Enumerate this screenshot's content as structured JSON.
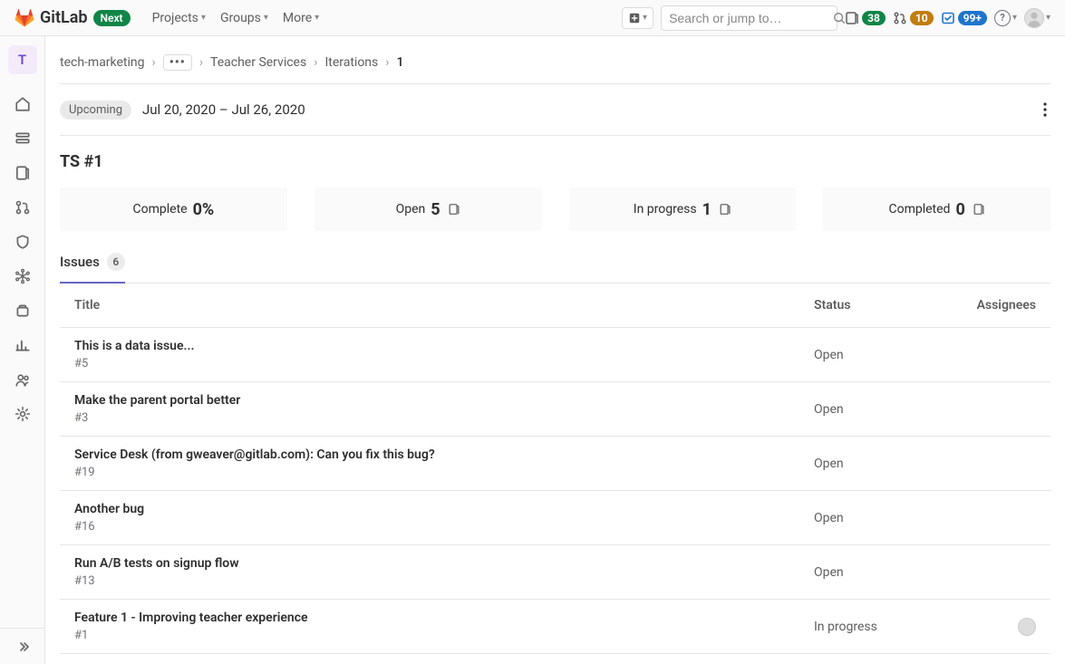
{
  "brand": {
    "name": "GitLab",
    "next_badge": "Next"
  },
  "nav": {
    "projects": "Projects",
    "groups": "Groups",
    "more": "More"
  },
  "search": {
    "placeholder": "Search or jump to…"
  },
  "counters": {
    "issues": "38",
    "mrs": "10",
    "todos": "99+"
  },
  "sidebar": {
    "project_initial": "T"
  },
  "breadcrumbs": {
    "root": "tech-marketing",
    "group": "Teacher Services",
    "section": "Iterations",
    "current": "1"
  },
  "iteration": {
    "status": "Upcoming",
    "date_range": "Jul 20, 2020 – Jul 26, 2020",
    "title": "TS #1"
  },
  "stats": {
    "complete": {
      "label": "Complete",
      "value": "0%"
    },
    "open": {
      "label": "Open",
      "value": "5"
    },
    "in_progress": {
      "label": "In progress",
      "value": "1"
    },
    "completed": {
      "label": "Completed",
      "value": "0"
    }
  },
  "tabs": {
    "issues": {
      "label": "Issues",
      "count": "6"
    }
  },
  "table": {
    "headers": {
      "title": "Title",
      "status": "Status",
      "assignees": "Assignees"
    }
  },
  "issues": [
    {
      "title": "This is a data issue...",
      "ref": "#5",
      "status": "Open",
      "has_assignee": false
    },
    {
      "title": "Make the parent portal better",
      "ref": "#3",
      "status": "Open",
      "has_assignee": false
    },
    {
      "title": "Service Desk (from gweaver@gitlab.com): Can you fix this bug?",
      "ref": "#19",
      "status": "Open",
      "has_assignee": false
    },
    {
      "title": "Another bug",
      "ref": "#16",
      "status": "Open",
      "has_assignee": false
    },
    {
      "title": "Run A/B tests on signup flow",
      "ref": "#13",
      "status": "Open",
      "has_assignee": false
    },
    {
      "title": "Feature 1 - Improving teacher experience",
      "ref": "#1",
      "status": "In progress",
      "has_assignee": true
    }
  ]
}
